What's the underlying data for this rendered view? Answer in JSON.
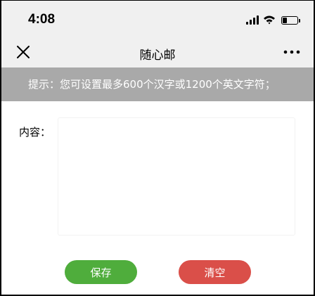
{
  "status_bar": {
    "time": "4:08",
    "battery_level_percent": 30,
    "icons": [
      "cellular-signal-icon",
      "wifi-icon",
      "battery-icon"
    ]
  },
  "nav": {
    "title": "随心邮",
    "icons": [
      "close-icon",
      "more-icon"
    ]
  },
  "tip": {
    "text": "提示：您可设置最多600个汉字或1200个英文字符；"
  },
  "form": {
    "content_label": "内容：",
    "content_value": ""
  },
  "buttons": {
    "save_label": "保存",
    "clear_label": "清空"
  },
  "colors": {
    "status_bg": "#f0f0f0",
    "tip_bg": "#a9a9a9",
    "save": "#4fad3c",
    "clear": "#da4f49"
  }
}
